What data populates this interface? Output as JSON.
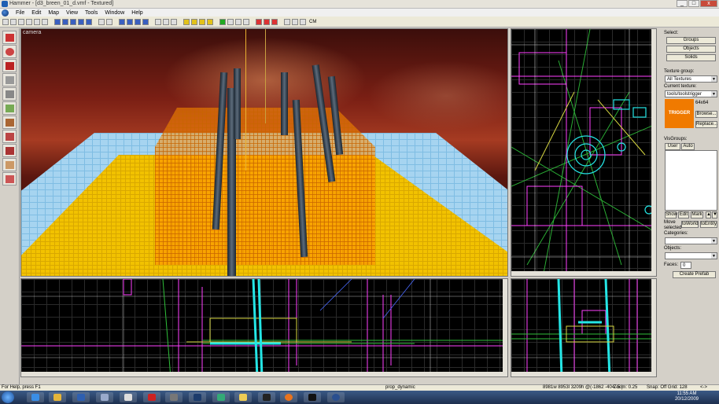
{
  "window": {
    "title": "Hammer - [d3_breen_01_d.vmf - Textured]",
    "controls": [
      "_",
      "□",
      "x"
    ]
  },
  "menu": {
    "items": [
      "File",
      "Edit",
      "Map",
      "View",
      "Tools",
      "Window",
      "Help"
    ]
  },
  "toolbar": {
    "cm_label": "CM"
  },
  "viewports": {
    "camera_label": "camera"
  },
  "right_panel": {
    "select_label": "Select:",
    "groups_button": "Groups",
    "objects_button": "Objects",
    "solids_button": "Solids",
    "texture_group_label": "Texture group:",
    "texture_group_value": "All Textures",
    "current_texture_label": "Current texture:",
    "current_texture_value": "tools/toolstrigger",
    "texture_size": "64x64",
    "texture_swatch_text": "TRIGGER",
    "browse_button": "Browse...",
    "replace_button": "Replace...",
    "visgroups_label": "VisGroups:",
    "tab_user": "User",
    "tab_auto": "Auto",
    "show_button": "Show",
    "edit_button": "Edit",
    "mark_button": "Mark",
    "move_selected_label": "Move selected",
    "to_world_button": "toWorld",
    "to_entity_button": "toEntity",
    "categories_label": "Categories:",
    "objects_label": "Objects:",
    "faces_label": "Faces:",
    "faces_value": "0",
    "create_prefab_button": "Create Prefab"
  },
  "statusbar": {
    "help": "For Help, press F1",
    "entity": "prop_dynamic",
    "size": "8981w 8953l 3209h @(-1862 -404 -5 )",
    "zoom": "Zoom: 0.25",
    "snap": "Snap: Off Grid: 128",
    "tail": "<->"
  },
  "taskbar": {
    "time": "11:55 AM",
    "date": "20/12/2009"
  }
}
